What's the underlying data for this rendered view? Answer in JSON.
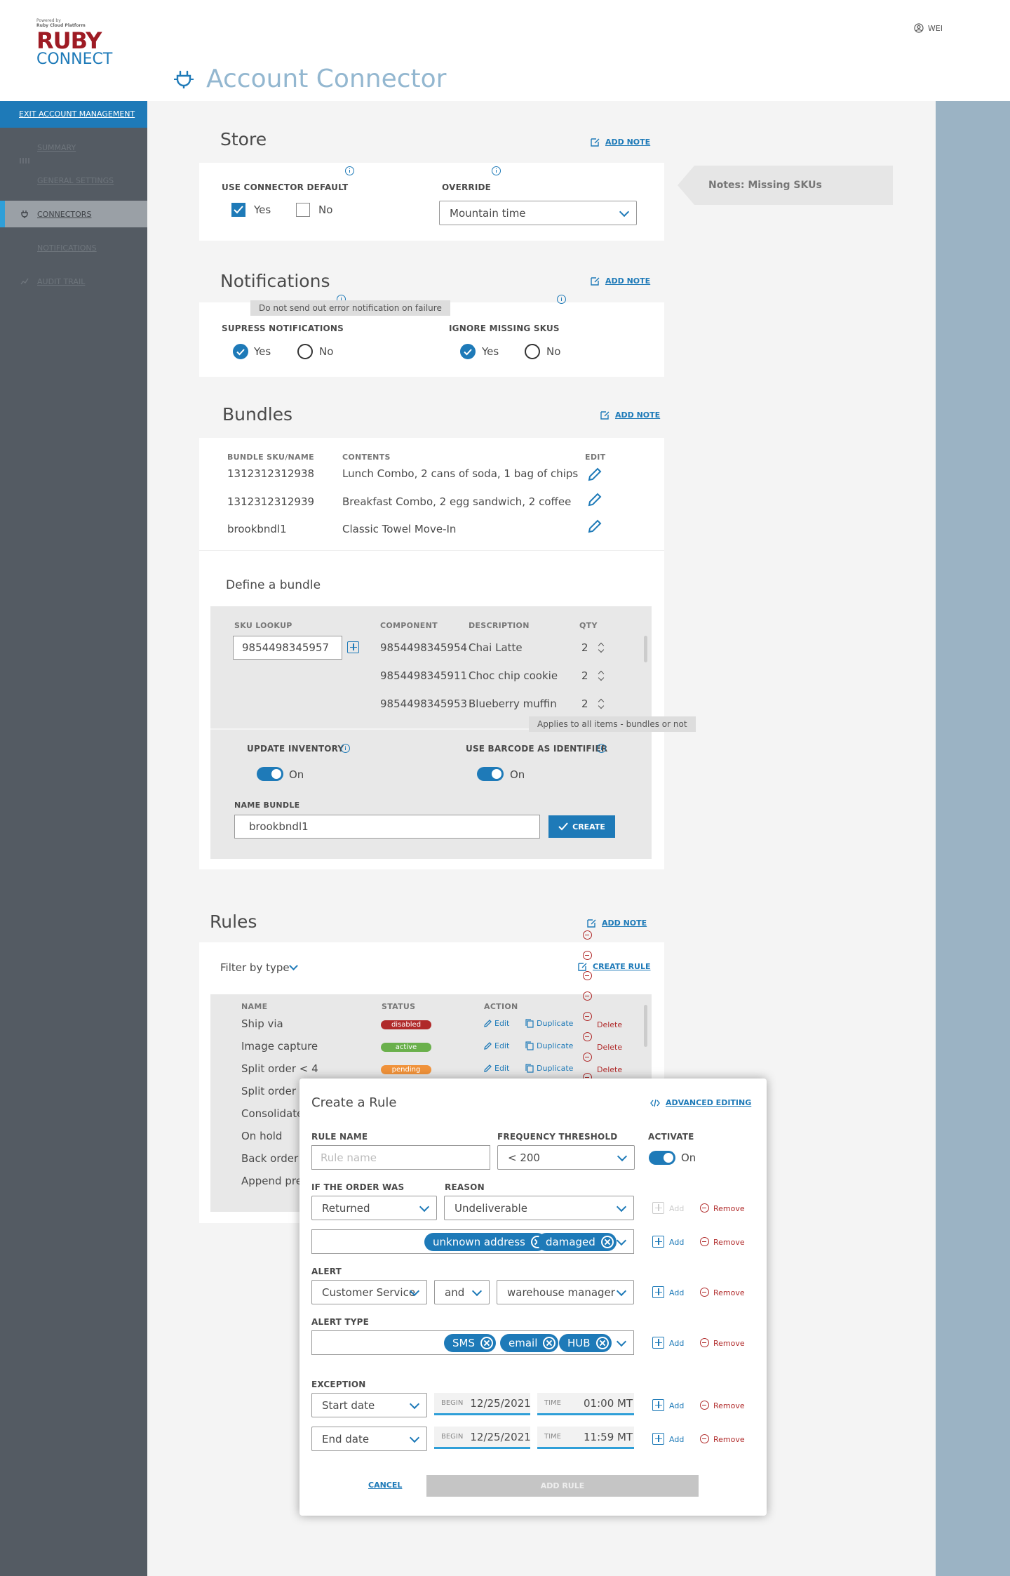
{
  "header": {
    "powered": "Powered by",
    "platform": "Ruby Cloud Platform",
    "logo_top": "RUBY",
    "logo_bottom": "CONNECT",
    "page_title": "Account Connector",
    "user": "WEI"
  },
  "sidebar": {
    "exit": "EXIT ACCOUNT MANAGEMENT",
    "items": [
      {
        "label": "SUMMARY",
        "icon": "dots-icon"
      },
      {
        "label": "GENERAL SETTINGS",
        "icon": "settings-icon"
      },
      {
        "label": "CONNECTORS",
        "icon": "plug-icon"
      },
      {
        "label": "NOTIFICATIONS",
        "icon": "bell-icon"
      },
      {
        "label": "AUDIT TRAIL",
        "icon": "trail-icon"
      }
    ]
  },
  "store": {
    "title": "Store",
    "add_note": "ADD NOTE",
    "use_default_label": "USE CONNECTOR DEFAULT",
    "yes": "Yes",
    "no": "No",
    "override_label": "OVERRIDE",
    "override_value": "Mountain time",
    "note": "Notes: Missing SKUs"
  },
  "notifications": {
    "title": "Notifications",
    "add_note": "ADD NOTE",
    "tooltip": "Do not send out error notification on failure",
    "suppress_label": "SUPRESS NOTIFICATIONS",
    "ignore_label": "IGNORE MISSING SKUS",
    "yes": "Yes",
    "no": "No"
  },
  "bundles": {
    "title": "Bundles",
    "add_note": "ADD NOTE",
    "columns": [
      "BUNDLE SKU/NAME",
      "CONTENTS",
      "EDIT"
    ],
    "rows": [
      {
        "sku": "1312312312938",
        "contents": "Lunch Combo, 2 cans of soda, 1 bag of chips"
      },
      {
        "sku": "1312312312939",
        "contents": "Breakfast Combo, 2 egg sandwich, 2 coffee"
      },
      {
        "sku": "brookbndl1",
        "contents": "Classic Towel Move-In"
      }
    ],
    "define_title": "Define a bundle",
    "sku_lookup_label": "SKU LOOKUP",
    "sku_lookup_value": "9854498345957",
    "component_columns": [
      "COMPONENT",
      "DESCRIPTION",
      "QTY"
    ],
    "components": [
      {
        "component": "9854498345954",
        "description": "Chai Latte",
        "qty": "2"
      },
      {
        "component": "9854498345911",
        "description": "Choc chip cookie",
        "qty": "2"
      },
      {
        "component": "9854498345953",
        "description": "Blueberry muffin",
        "qty": "2"
      }
    ],
    "tooltip": "Applies to all items - bundles or not",
    "update_inventory_label": "UPDATE INVENTORY",
    "use_barcode_label": "USE BARCODE AS IDENTIFIER",
    "on": "On",
    "name_bundle_label": "NAME BUNDLE",
    "name_bundle_value": "brookbndl1",
    "create": "CREATE"
  },
  "rules": {
    "title": "Rules",
    "add_note": "ADD NOTE",
    "filter": "Filter by type",
    "create_rule": "CREATE RULE",
    "columns": [
      "NAME",
      "STATUS",
      "ACTION"
    ],
    "rows": [
      {
        "name": "Ship via",
        "status": "disabled",
        "status_color": "#b02a2a"
      },
      {
        "name": "Image capture",
        "status": "active",
        "status_color": "#6ab04c"
      },
      {
        "name": "Split order < 4",
        "status": "pending",
        "status_color": "#f0923a"
      },
      {
        "name": "Split order <",
        "status": ""
      },
      {
        "name": "Consolidate o",
        "status": ""
      },
      {
        "name": "On hold",
        "status": ""
      },
      {
        "name": "Back order",
        "status": ""
      },
      {
        "name": "Append prefi",
        "status": ""
      }
    ],
    "edit": "Edit",
    "duplicate": "Duplicate",
    "delete": "Delete"
  },
  "modal": {
    "title": "Create a Rule",
    "advanced": "ADVANCED EDITING",
    "rule_name_label": "RULE NAME",
    "rule_name_placeholder": "Rule name",
    "frequency_label": "FREQUENCY THRESHOLD",
    "frequency_value": "< 200",
    "activate_label": "ACTIVATE",
    "on": "On",
    "order_was_label": "IF THE ORDER WAS",
    "order_was_value": "Returned",
    "reason_label": "REASON",
    "reason_value": "Undeliverable",
    "reason_chips": [
      "unknown address",
      "damaged"
    ],
    "alert_label": "ALERT",
    "alert_value": "Customer Service",
    "alert_join": "and",
    "alert_value2": "warehouse manager",
    "alert_type_label": "ALERT TYPE",
    "alert_type_chips": [
      "SMS",
      "email",
      "HUB"
    ],
    "exception_label": "EXCEPTION",
    "exceptions": [
      {
        "type": "Start date",
        "begin": "12/25/2021",
        "time": "01:00 MT"
      },
      {
        "type": "End date",
        "begin": "12/25/2021",
        "time": "11:59 MT"
      }
    ],
    "begin_key": "BEGIN",
    "time_key": "TIME",
    "add": "Add",
    "remove": "Remove",
    "cancel": "CANCEL",
    "add_rule": "ADD RULE"
  }
}
